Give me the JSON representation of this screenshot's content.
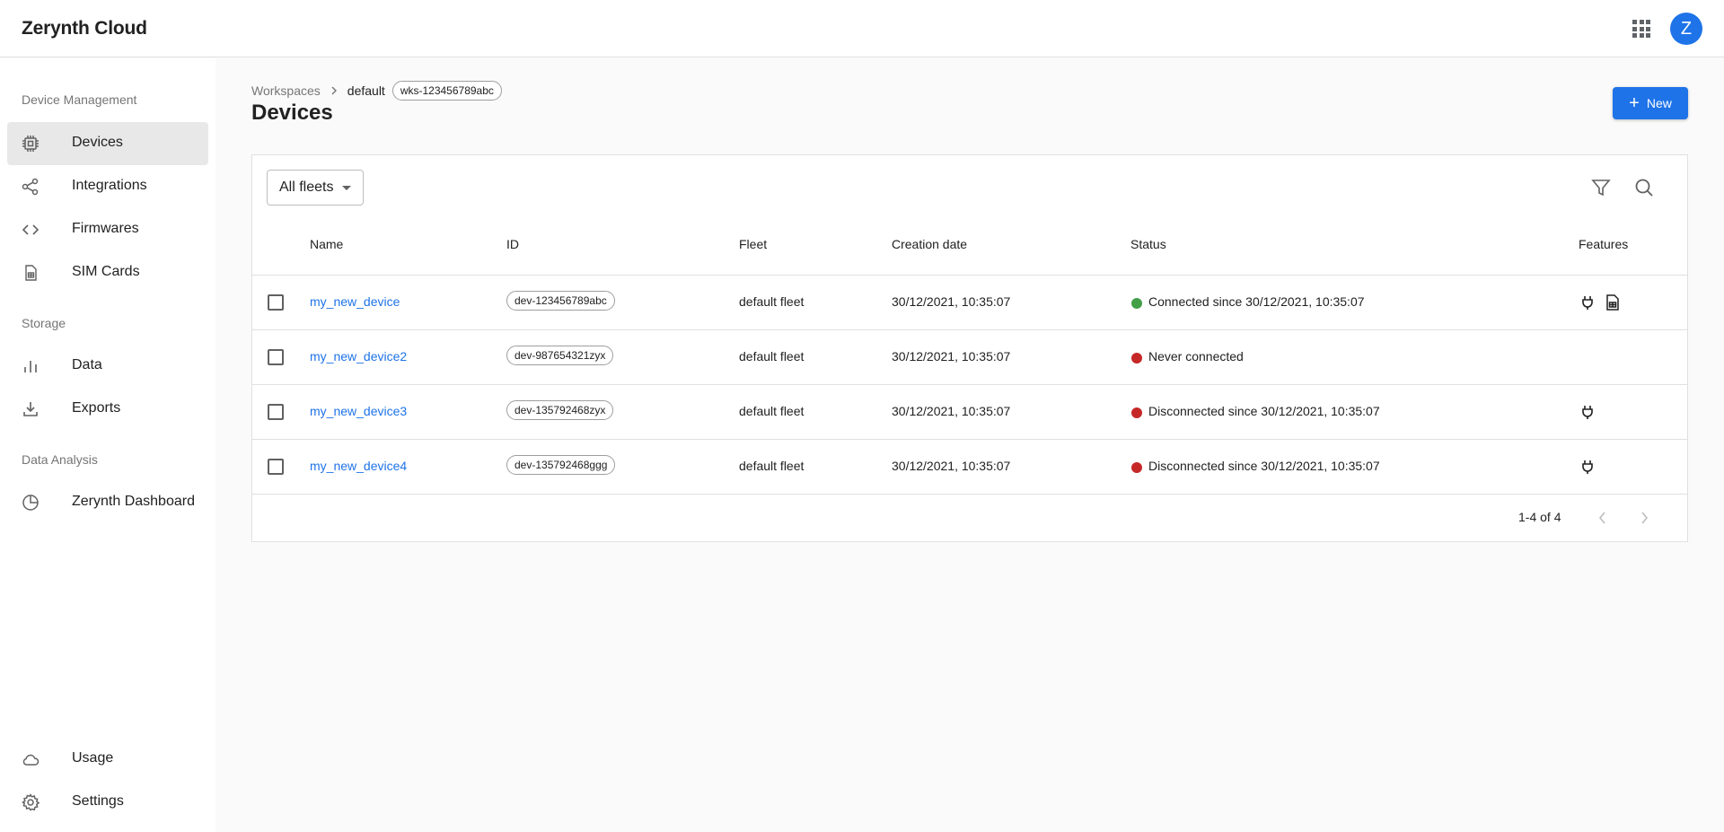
{
  "app": {
    "title": "Zerynth Cloud",
    "avatar_letter": "Z"
  },
  "sidebar": {
    "sections": [
      "Device Management",
      "Storage",
      "Data Analysis"
    ],
    "items": [
      {
        "label": "Devices",
        "icon": "chip-icon",
        "active": true
      },
      {
        "label": "Integrations",
        "icon": "share-icon"
      },
      {
        "label": "Firmwares",
        "icon": "code-icon"
      },
      {
        "label": "SIM Cards",
        "icon": "sim-card-icon"
      },
      {
        "label": "Data",
        "icon": "bar-chart-icon"
      },
      {
        "label": "Exports",
        "icon": "download-icon"
      },
      {
        "label": "Zerynth Dashboard",
        "icon": "pie-chart-icon"
      },
      {
        "label": "Usage",
        "icon": "cloud-icon"
      },
      {
        "label": "Settings",
        "icon": "gear-icon"
      }
    ]
  },
  "breadcrumb": {
    "workspaces": "Workspaces",
    "current": "default",
    "workspace_id": "wks-123456789abc"
  },
  "page": {
    "title": "Devices",
    "new_button": "New"
  },
  "filters": {
    "fleet_select": "All fleets"
  },
  "table": {
    "headers": {
      "name": "Name",
      "id": "ID",
      "fleet": "Fleet",
      "created": "Creation date",
      "status": "Status",
      "features": "Features"
    },
    "rows": [
      {
        "name": "my_new_device",
        "id": "dev-123456789abc",
        "fleet": "default fleet",
        "created": "30/12/2021, 10:35:07",
        "status": "Connected since 30/12/2021, 10:35:07",
        "status_color": "#43a047",
        "features": [
          "plug-icon",
          "sim-card-icon"
        ]
      },
      {
        "name": "my_new_device2",
        "id": "dev-987654321zyx",
        "fleet": "default fleet",
        "created": "30/12/2021, 10:35:07",
        "status": "Never connected",
        "status_color": "#c62828",
        "features": []
      },
      {
        "name": "my_new_device3",
        "id": "dev-135792468zyx",
        "fleet": "default fleet",
        "created": "30/12/2021, 10:35:07",
        "status": "Disconnected since 30/12/2021, 10:35:07",
        "status_color": "#c62828",
        "features": [
          "plug-icon"
        ]
      },
      {
        "name": "my_new_device4",
        "id": "dev-135792468ggg",
        "fleet": "default fleet",
        "created": "30/12/2021, 10:35:07",
        "status": "Disconnected since 30/12/2021, 10:35:07",
        "status_color": "#c62828",
        "features": [
          "plug-icon"
        ]
      }
    ]
  },
  "pagination": {
    "range": "1-4 of 4"
  },
  "colors": {
    "accent": "#1e73e8",
    "connected": "#43a047",
    "disconnected": "#c62828"
  }
}
